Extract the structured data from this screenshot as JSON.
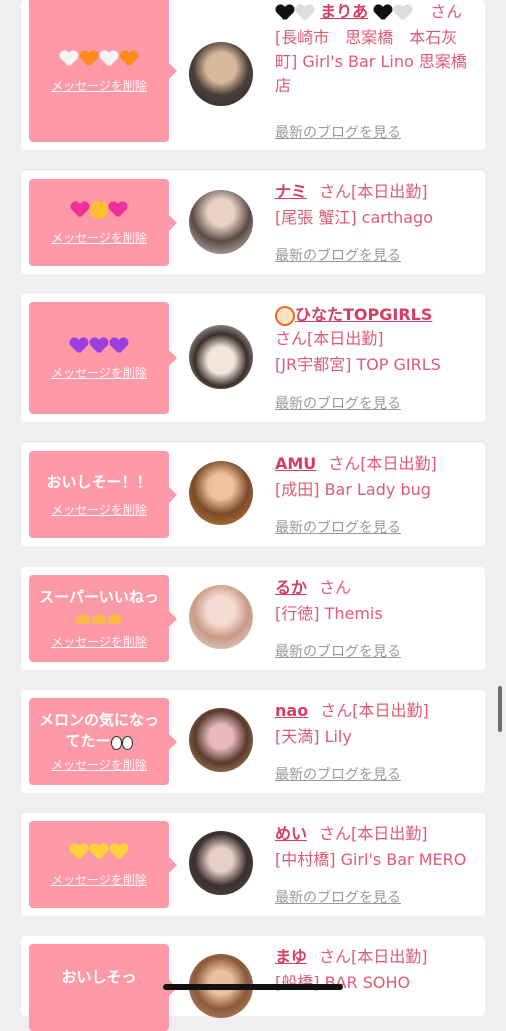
{
  "delete_label": "メッセージを削除",
  "blog_label": "最新のブログを見る",
  "san": "さん",
  "colors": {
    "bubble": "#fe99a7",
    "name": "#d63d63",
    "shop": "#e05a78",
    "blog": "#9a9a9a"
  },
  "cards": [
    {
      "message": "",
      "message_icons": "white-orange-hearts",
      "name": "まりあ",
      "status": "",
      "shop": "[長崎市　思案橋　本石灰町] Girl's Bar Lino 思案橋店"
    },
    {
      "message": "",
      "message_icons": "pink-hearts-face",
      "name": "ナミ",
      "status": "[本日出勤]",
      "shop": "[尾張 蟹江] carthago"
    },
    {
      "message": "",
      "message_icons": "purple-hearts",
      "name": "ひなたTOPGIRLS",
      "status": "[本日出勤]",
      "shop": "[JR宇都宮] TOP GIRLS"
    },
    {
      "message": "おいしそー！！",
      "message_icons": "",
      "name": "AMU",
      "status": "[本日出勤]",
      "shop": "[成田] Bar Lady bug"
    },
    {
      "message": "スーパーいいねっ",
      "message_icons": "hands",
      "name": "るか",
      "status": "",
      "shop": "[行徳] Themis"
    },
    {
      "message": "メロンの気になってたー",
      "message_icons": "eyes",
      "name": "nao",
      "status": "[本日出勤]",
      "shop": "[天満] Lily"
    },
    {
      "message": "",
      "message_icons": "yellow-hearts",
      "name": "めい",
      "status": "[本日出勤]",
      "shop": "[中村橋] Girl's Bar MERO"
    },
    {
      "message": "おいしそっ",
      "message_icons": "",
      "name": "まゆ",
      "status": "[本日出勤]",
      "shop": "[船橋] BAR SOHO"
    }
  ]
}
